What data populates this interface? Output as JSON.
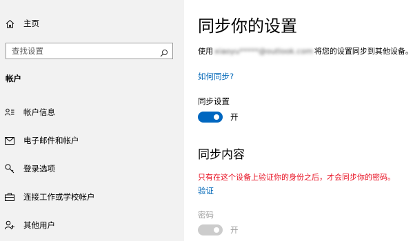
{
  "sidebar": {
    "home_label": "主页",
    "search_placeholder": "查找设置",
    "section_title": "帐户",
    "items": [
      {
        "label": "帐户信息",
        "icon": "account-info-icon"
      },
      {
        "label": "电子邮件和帐户",
        "icon": "mail-icon"
      },
      {
        "label": "登录选项",
        "icon": "key-icon"
      },
      {
        "label": "连接工作或学校帐户",
        "icon": "briefcase-icon"
      },
      {
        "label": "其他用户",
        "icon": "add-person-icon"
      }
    ]
  },
  "main": {
    "title": "同步你的设置",
    "description_prefix": "使用",
    "description_email": "xiaoyu*****@outlook.com",
    "description_suffix": "将您的设置同步到其他设备。",
    "how_to_sync_link": "如何同步?",
    "sync_settings_label": "同步设置",
    "sync_settings_state": "开",
    "sync_content_heading": "同步内容",
    "warning_text": "只有在这个设备上验证你的身份之后，才会同步你的密码。",
    "verify_link": "验证",
    "password_label": "密码",
    "password_state": "开"
  },
  "colors": {
    "accent": "#0067c0",
    "link": "#0067b8",
    "warning": "#e81123",
    "sidebar_bg": "#f2f2f2",
    "disabled": "#a0a0a0"
  }
}
